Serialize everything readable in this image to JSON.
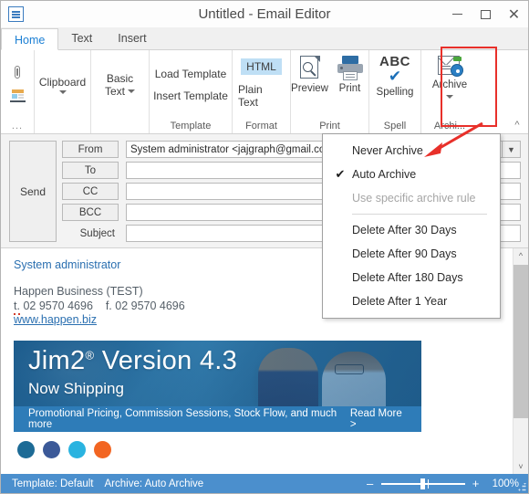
{
  "window": {
    "title": "Untitled - Email Editor",
    "app_icon": "email-editor-icon",
    "minimize": "–",
    "maximize": "□",
    "close": "✕"
  },
  "tabs": [
    {
      "label": "Home",
      "active": true
    },
    {
      "label": "Text",
      "active": false
    },
    {
      "label": "Insert",
      "active": false
    }
  ],
  "ribbon": {
    "icons_group": {
      "attach_icon": "paperclip-icon",
      "signature_icon": "signature-icon",
      "overflow_label": "..."
    },
    "clipboard": {
      "label": "Clipboard"
    },
    "basic_text": {
      "label": "Basic\nText",
      "line1": "Basic",
      "line2": "Text"
    },
    "template": {
      "load": "Load Template",
      "insert": "Insert Template",
      "group_label": "Template"
    },
    "format": {
      "html": "HTML",
      "plain_text": "Plain Text",
      "group_label": "Format",
      "selected": "HTML",
      "selected_color": "#bfdff5"
    },
    "print": {
      "preview": "Preview",
      "print": "Print",
      "group_label": "Print"
    },
    "spell": {
      "abc": "ABC",
      "spelling": "Spelling",
      "group_label": "Spell"
    },
    "archive": {
      "label": "Archive",
      "group_label": "Archi...",
      "highlight_color": "#e8302a"
    },
    "collapse_icon": "chevron-up-icon"
  },
  "header": {
    "send": "Send",
    "from_label": "From",
    "from_value": "System administrator <jajgraph@gmail.com>",
    "to_label": "To",
    "to_value": "",
    "cc_label": "CC",
    "cc_value": "",
    "bcc_label": "BCC",
    "bcc_value": "",
    "subject_label": "Subject",
    "subject_value": ""
  },
  "body": {
    "signature_name": "System administrator",
    "company": "Happen Business (TEST)",
    "phone_prefix": "t.",
    "phone": "02 9570 4696",
    "fax_prefix": "f.",
    "fax": "02 9570 4696",
    "website": "www.happen.biz",
    "banner": {
      "title": "Jim2",
      "title_sup": "®",
      "version": "Version 4.3",
      "subtitle": "Now Shipping",
      "tagline": "Promotional Pricing, Commission Sessions, Stock Flow, and much more",
      "read_more": "Read More >",
      "bar_color": "#2e7cb8"
    },
    "socials": [
      "social-linkedin",
      "social-facebook",
      "social-twitter",
      "social-rss"
    ]
  },
  "menu": {
    "items": [
      {
        "label": "Never Archive",
        "checked": false,
        "disabled": false
      },
      {
        "label": "Auto Archive",
        "checked": true,
        "disabled": false
      },
      {
        "label": "Use specific archive rule",
        "checked": false,
        "disabled": true
      },
      {
        "separator": true
      },
      {
        "label": "Delete After 30 Days",
        "checked": false,
        "disabled": false
      },
      {
        "label": "Delete After 90 Days",
        "checked": false,
        "disabled": false
      },
      {
        "label": "Delete After 180 Days",
        "checked": false,
        "disabled": false
      },
      {
        "label": "Delete After 1 Year",
        "checked": false,
        "disabled": false
      }
    ],
    "check_glyph": "✔"
  },
  "statusbar": {
    "template_status": "Template: Default",
    "archive_status": "Archive: Auto Archive",
    "zoom_minus": "–",
    "zoom_plus": "+",
    "zoom_percent": "100%",
    "background": "#4b8fcd"
  },
  "scrollbar": {
    "up_icon": "chevron-up-icon",
    "down_icon": "chevron-down-icon"
  }
}
